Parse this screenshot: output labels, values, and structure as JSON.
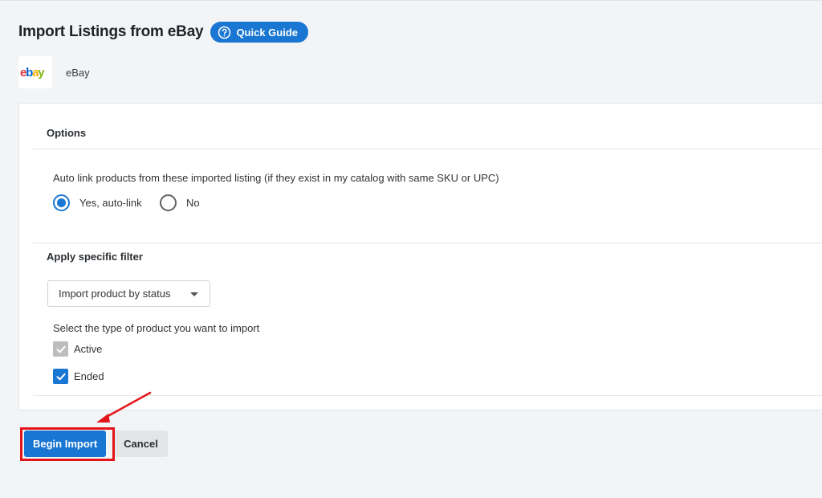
{
  "header": {
    "title": "Import Listings from eBay",
    "guide_label": "Quick Guide"
  },
  "channel": {
    "name": "eBay",
    "logo_letters": [
      "e",
      "b",
      "a",
      "y"
    ],
    "logo_colors": [
      "#e53238",
      "#0064d2",
      "#f5af02",
      "#86b817"
    ]
  },
  "options": {
    "heading": "Options",
    "autolink_question": "Auto link products from these imported listing (if they exist in my catalog with same SKU or UPC)",
    "radios": [
      {
        "label": "Yes, auto-link",
        "selected": true
      },
      {
        "label": "No",
        "selected": false
      }
    ]
  },
  "filter": {
    "heading": "Apply specific filter",
    "dropdown_value": "Import product by status",
    "type_prompt": "Select the type of product you want to import",
    "checkboxes": [
      {
        "label": "Active",
        "checked": true,
        "disabled": true
      },
      {
        "label": "Ended",
        "checked": true,
        "disabled": false
      }
    ]
  },
  "actions": {
    "primary_label": "Begin Import",
    "cancel_label": "Cancel"
  },
  "colors": {
    "accent": "#1976d2",
    "annotation": "#e3151a"
  }
}
